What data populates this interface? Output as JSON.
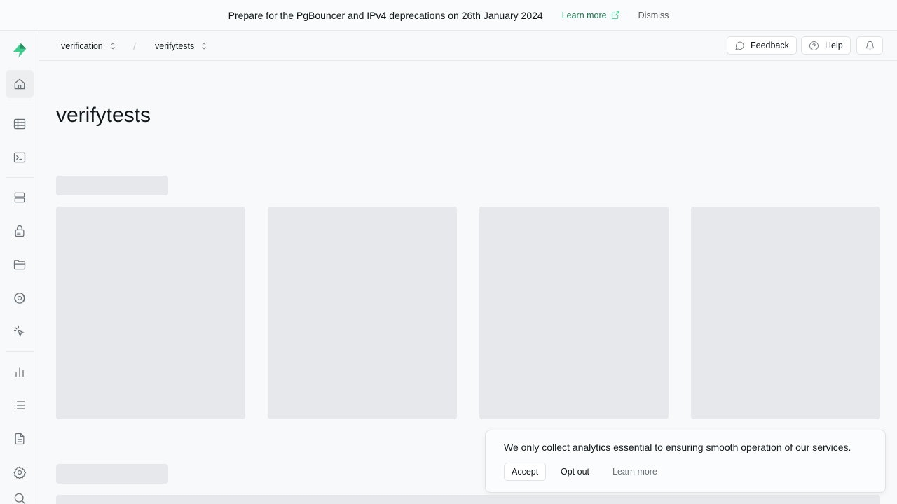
{
  "banner": {
    "text": "Prepare for the PgBouncer and IPv4 deprecations on 26th January 2024",
    "learn_more": "Learn more",
    "dismiss": "Dismiss"
  },
  "header": {
    "org": "verification",
    "project": "verifytests",
    "separator": "/",
    "feedback": "Feedback",
    "help": "Help"
  },
  "sidebar": {
    "items": [
      "home-icon",
      "table-editor-icon",
      "sql-editor-icon",
      "database-icon",
      "auth-icon",
      "storage-icon",
      "realtime-icon",
      "edge-functions-icon",
      "reports-icon",
      "logs-icon",
      "api-docs-icon",
      "settings-icon",
      "search-icon"
    ]
  },
  "main": {
    "title": "verifytests"
  },
  "toast": {
    "message": "We only collect analytics essential to ensuring smooth operation of our services.",
    "accept": "Accept",
    "opt_out": "Opt out",
    "learn_more": "Learn more"
  },
  "colors": {
    "brand": "#3ecf8e",
    "link_green": "#18794e",
    "skeleton": "#e6e8eb"
  }
}
